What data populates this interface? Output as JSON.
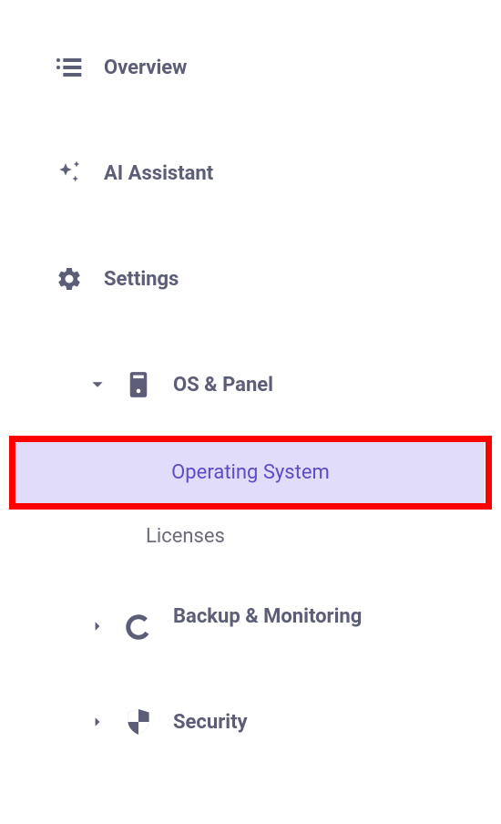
{
  "nav": {
    "overview": "Overview",
    "ai_assistant": "AI Assistant",
    "settings": "Settings",
    "os_panel": "OS & Panel",
    "operating_system": "Operating System",
    "licenses": "Licenses",
    "backup_monitoring": "Backup & Monitoring",
    "security": "Security"
  }
}
